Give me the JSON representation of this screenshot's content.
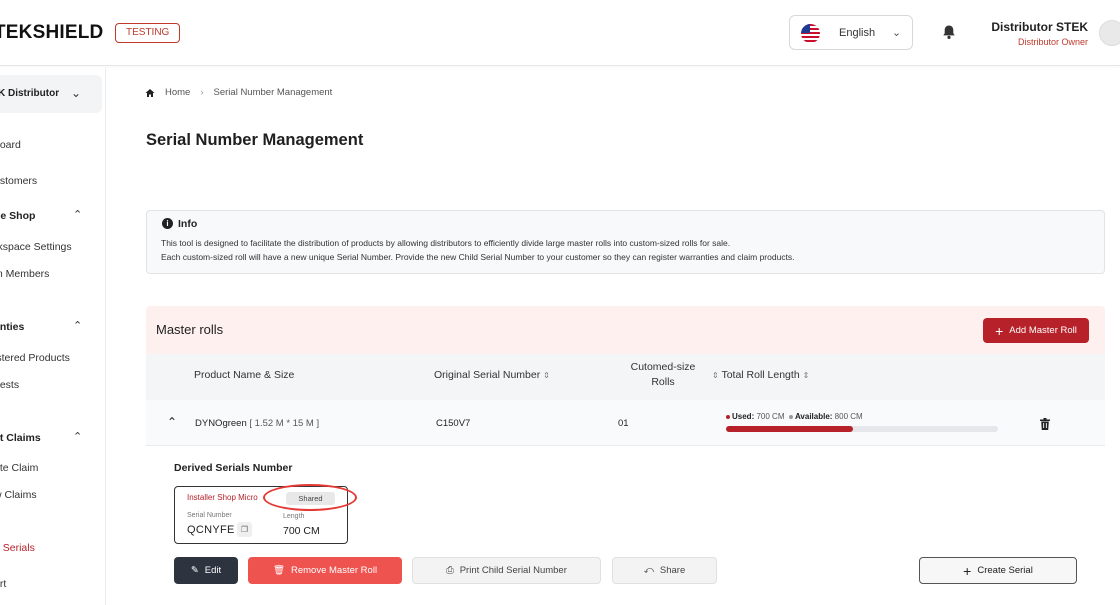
{
  "header": {
    "logo": "TEKSHIELD",
    "env_badge": "TESTING",
    "language": "English",
    "user_name": "Distributor STEK",
    "user_role": "Distributor Owner"
  },
  "sidebar": {
    "distributor_select": "K Distributor",
    "items": [
      {
        "label": "board"
      },
      {
        "label": "ustomers"
      },
      {
        "label": "ge Shop"
      },
      {
        "label": "rkspace Settings"
      },
      {
        "label": "m Members"
      },
      {
        "label": "anties"
      },
      {
        "label": "istered Products"
      },
      {
        "label": "uests"
      },
      {
        "label": "ct Claims"
      },
      {
        "label": "ate Claim"
      },
      {
        "label": "w Claims"
      },
      {
        "label": "e Serials"
      },
      {
        "label": "ort"
      }
    ]
  },
  "breadcrumb": {
    "home": "Home",
    "current": "Serial Number Management"
  },
  "page_title": "Serial Number Management",
  "info": {
    "title": "Info",
    "line1": "This tool is designed to facilitate the distribution of products by allowing distributors to efficiently divide large master rolls into custom-sized rolls for sale.",
    "line2": "Each custom-sized roll will have a new unique Serial Number. Provide the new Child Serial Number to your customer so they can register warranties and claim products."
  },
  "master_rolls": {
    "title": "Master rolls",
    "add_button": "Add Master Roll",
    "columns": {
      "product": "Product Name & Size",
      "original_serial": "Original Serial Number",
      "custom_rolls_1": "Cutomed-size",
      "custom_rolls_2": "Rolls",
      "total_length": "Total Roll Length"
    },
    "row": {
      "product_name": "DYNOgreen",
      "product_size": "[ 1.52 M * 15 M ]",
      "original_serial": "C150V7",
      "custom_rolls": "01",
      "used_label": "Used:",
      "used_value": "700 CM",
      "available_label": "Available:",
      "available_value": "800 CM",
      "used_fraction": 0.4667
    },
    "derived": {
      "title": "Derived Serials Number",
      "card": {
        "shop": "Installer Shop Micro",
        "badge": "Shared",
        "serial_label": "Serial Number",
        "serial": "QCNYFE",
        "length_label": "Length",
        "length": "700 CM"
      }
    },
    "actions": {
      "edit": "Edit",
      "remove": "Remove Master Roll",
      "print": "Print Child Serial Number",
      "share": "Share",
      "create": "Create Serial"
    }
  },
  "colors": {
    "brand_red": "#b7222a",
    "remove_red": "#ef5350",
    "highlight_red": "#e53935",
    "dark_button": "#2d3440"
  }
}
